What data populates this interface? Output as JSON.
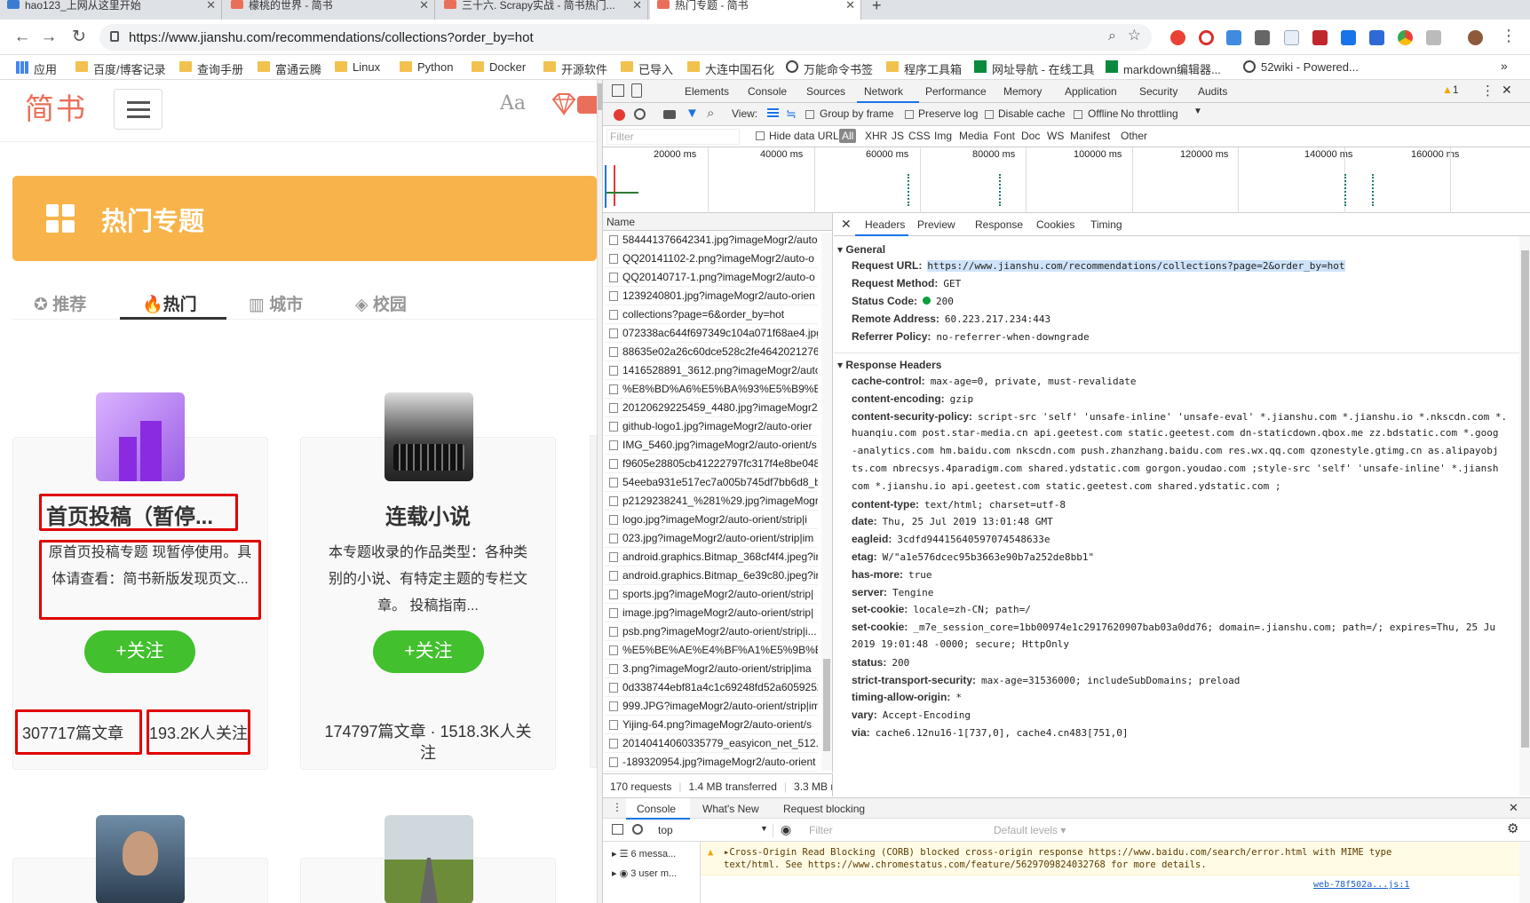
{
  "tabs": [
    {
      "title": "hao123_上网从这里开始"
    },
    {
      "title": "檬桃的世界 - 简书"
    },
    {
      "title": "三十六. Scrapy实战 - 简书热门..."
    },
    {
      "title": "热门专题 - 简书"
    }
  ],
  "new_tab": "+",
  "address": {
    "url": "https://www.jianshu.com/recommendations/collections?order_by=hot"
  },
  "bookmarks": [
    "应用",
    "百度/博客记录",
    "查询手册",
    "富通云腾",
    "Linux",
    "Python",
    "Docker",
    "开源软件",
    "已导入",
    "大连中国石化",
    "万能命令书签",
    "程序工具箱",
    "网址导航 - 在线工具",
    "markdown编辑器...",
    "52wiki - Powered..."
  ],
  "bookmarks_more": "»",
  "site": {
    "logo": "简书",
    "font_icon": "Aa",
    "banner_title": "热门专题",
    "tabs": [
      "推荐",
      "热门",
      "城市",
      "校园"
    ],
    "active_tab": "热门",
    "collections": [
      {
        "title": "首页投稿（暂停...",
        "desc": "原首页投稿专题 现暂停使用。具体请查看：简书新版发现页文...",
        "follow": "+关注",
        "articles": "307717篇文章",
        "followers": "193.2K人关注"
      },
      {
        "title": "连载小说",
        "desc": "本专题收录的作品类型：各种类别的小说、有特定主题的专栏文章。 投稿指南...",
        "follow": "+关注",
        "stats": "174797篇文章 · 1518.3K人关注"
      }
    ]
  },
  "devtools": {
    "tabs": [
      "Elements",
      "Console",
      "Sources",
      "Network",
      "Performance",
      "Memory",
      "Application",
      "Security",
      "Audits"
    ],
    "active_tab": "Network",
    "warnings_count": "1",
    "toolbar": {
      "view": "View:",
      "group_by_frame": "Group by frame",
      "preserve_log": "Preserve log",
      "disable_cache": "Disable cache",
      "offline": "Offline",
      "throttling": "No throttling"
    },
    "filter_placeholder": "Filter",
    "hide_data_urls": "Hide data URLs",
    "type_filters": [
      "All",
      "XHR",
      "JS",
      "CSS",
      "Img",
      "Media",
      "Font",
      "Doc",
      "WS",
      "Manifest",
      "Other"
    ],
    "timeline_ticks": [
      "20000 ms",
      "40000 ms",
      "60000 ms",
      "80000 ms",
      "100000 ms",
      "120000 ms",
      "140000 ms",
      "160000 ms"
    ],
    "name_col": "Name",
    "requests": [
      "584441376642341.jpg?imageMogr2/auto",
      "QQ20141102-2.png?imageMogr2/auto-o",
      "QQ20140717-1.png?imageMogr2/auto-o",
      "1239240801.jpg?imageMogr2/auto-orien",
      "collections?page=6&order_by=hot",
      "072338ac644f697349c104a071f68ae4.jpg",
      "88635e02a26c60dce528c2fe46420212761",
      "1416528891_3612.png?imageMogr2/auto",
      "%E8%BD%A6%E5%BA%93%E5%B9%B3%",
      "20120629225459_4480.jpg?imageMogr2/",
      "github-logo1.jpg?imageMogr2/auto-orier",
      "IMG_5460.jpg?imageMogr2/auto-orient/s",
      "f9605e28805cb41222797fc317f4e8be048(",
      "54eeba931e517ec7a005b745df7bb6d8_b.",
      "p2129238241_%281%29.jpg?imageMogr2",
      "logo.jpg?imageMogr2/auto-orient/strip|i",
      "023.jpg?imageMogr2/auto-orient/strip|im",
      "android.graphics.Bitmap_368cf4f4.jpeg?ir",
      "android.graphics.Bitmap_6e39c80.jpeg?ir",
      "sports.jpg?imageMogr2/auto-orient/strip|",
      "image.jpg?imageMogr2/auto-orient/strip|",
      "psb.png?imageMogr2/auto-orient/strip|i...",
      "%E5%BE%AE%E4%BF%A1%E5%9B%BE%E",
      "3.png?imageMogr2/auto-orient/strip|ima",
      "0d338744ebf81a4c1c69248fd52a6059252",
      "999.JPG?imageMogr2/auto-orient/strip|im",
      "Yijing-64.png?imageMogr2/auto-orient/s",
      "20140414060335779_easyicon_net_512.pr",
      "-189320954.jpg?imageMogr2/auto-orient"
    ],
    "summary": [
      "170 requests",
      "1.4 MB transferred",
      "3.3 MB r"
    ],
    "detail_tabs": [
      "Headers",
      "Preview",
      "Response",
      "Cookies",
      "Timing"
    ],
    "active_detail_tab": "Headers",
    "general_title": "General",
    "general": [
      {
        "k": "Request URL:",
        "v": "https://www.jianshu.com/recommendations/collections?page=2&order_by=hot"
      },
      {
        "k": "Request Method:",
        "v": "GET"
      },
      {
        "k": "Status Code:",
        "v": "200"
      },
      {
        "k": "Remote Address:",
        "v": "60.223.217.234:443"
      },
      {
        "k": "Referrer Policy:",
        "v": "no-referrer-when-downgrade"
      }
    ],
    "response_title": "Response Headers",
    "response_headers": [
      {
        "k": "cache-control:",
        "v": "max-age=0, private, must-revalidate"
      },
      {
        "k": "content-encoding:",
        "v": "gzip"
      },
      {
        "k": "content-security-policy:",
        "v": "script-src 'self' 'unsafe-inline' 'unsafe-eval' *.jianshu.com *.jianshu.io *.nkscdn.com *."
      },
      {
        "k": "",
        "v": "huanqiu.com post.star-media.cn api.geetest.com static.geetest.com dn-staticdown.qbox.me zz.bdstatic.com *.goog"
      },
      {
        "k": "",
        "v": "-analytics.com hm.baidu.com nkscdn.com push.zhanzhang.baidu.com res.wx.qq.com qzonestyle.gtimg.cn as.alipayobj"
      },
      {
        "k": "",
        "v": "ts.com nbrecsys.4paradigm.com shared.ydstatic.com gorgon.youdao.com ;style-src 'self' 'unsafe-inline' *.jiansh"
      },
      {
        "k": "",
        "v": "com *.jianshu.io api.geetest.com static.geetest.com shared.ydstatic.com ;"
      },
      {
        "k": "content-type:",
        "v": "text/html; charset=utf-8"
      },
      {
        "k": "date:",
        "v": "Thu, 25 Jul 2019 13:01:48 GMT"
      },
      {
        "k": "eagleid:",
        "v": "3cdfd94415640597074548633e"
      },
      {
        "k": "etag:",
        "v": "W/\"a1e576dcec95b3663e90b7a252de8bb1\""
      },
      {
        "k": "has-more:",
        "v": "true"
      },
      {
        "k": "server:",
        "v": "Tengine"
      },
      {
        "k": "set-cookie:",
        "v": "locale=zh-CN; path=/"
      },
      {
        "k": "set-cookie:",
        "v": "_m7e_session_core=1bb00974e1c2917620907bab03a0dd76; domain=.jianshu.com; path=/; expires=Thu, 25 Ju"
      },
      {
        "k": "",
        "v": "2019 19:01:48 -0000; secure; HttpOnly"
      },
      {
        "k": "status:",
        "v": "200"
      },
      {
        "k": "strict-transport-security:",
        "v": "max-age=31536000; includeSubDomains; preload"
      },
      {
        "k": "timing-allow-origin:",
        "v": "*"
      },
      {
        "k": "vary:",
        "v": "Accept-Encoding"
      },
      {
        "k": "via:",
        "v": "cache6.12nu16-1[737,0], cache4.cn483[751,0]"
      }
    ],
    "drawer_tabs": [
      "Console",
      "What's New",
      "Request blocking"
    ],
    "console_context": "top",
    "console_filter": "Filter",
    "console_levels": "Default levels ▾",
    "console_groups": [
      "6 messa...",
      "3 user m..."
    ],
    "console_warning": "▸Cross-Origin Read Blocking (CORB) blocked cross-origin response https://www.baidu.com/search/error.html with MIME type",
    "console_warning2": "text/html. See https://www.chromestatus.com/feature/5629709824032768 for more details.",
    "console_source": "web-78f502a...js:1"
  }
}
